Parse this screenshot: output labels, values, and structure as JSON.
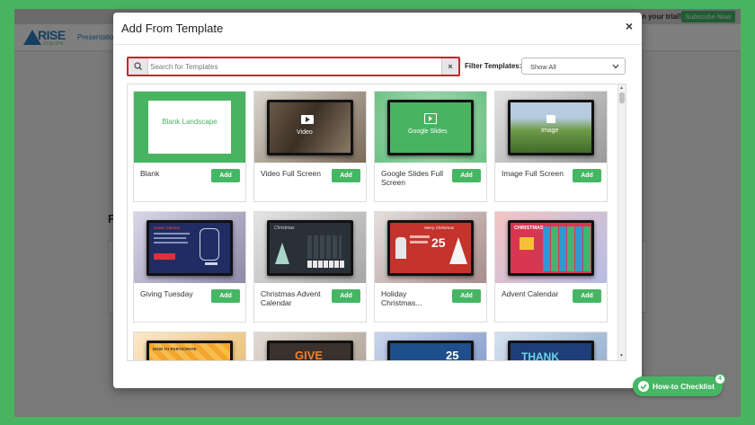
{
  "background_app": {
    "trial_text": "on your trial!",
    "subscribe_label": "Subscribe Now",
    "logo_text": "RISE",
    "logo_sub": "VISION",
    "nav_label": "Presentation",
    "heading_partial": "F"
  },
  "modal": {
    "title": "Add From Template",
    "close_label": "×",
    "search": {
      "placeholder": "Search for Templates",
      "value": "",
      "clear_label": "×"
    },
    "filter": {
      "label": "Filter Templates:",
      "selected": "Show All"
    },
    "add_label": "Add",
    "templates": [
      {
        "name": "Blank",
        "thumb_text": "Blank Landscape"
      },
      {
        "name": "Video Full Screen",
        "thumb_text": "Video"
      },
      {
        "name": "Google Slides Full Screen",
        "thumb_text": "Google Slides"
      },
      {
        "name": "Image Full Screen",
        "thumb_text": "Image"
      },
      {
        "name": "Giving Tuesday",
        "thumb_text": "GIVING TUESDAY"
      },
      {
        "name": "Christmas Advent Calendar",
        "thumb_text": "Christmas"
      },
      {
        "name": "Holiday Christmas...",
        "thumb_text": "Merry Christmas",
        "thumb_number": "25"
      },
      {
        "name": "Advent Calendar",
        "thumb_text": "CHRISTMAS"
      },
      {
        "name": "",
        "thumb_text": "HOW TO PARTICIPATE"
      },
      {
        "name": "",
        "thumb_text": "GIVE"
      },
      {
        "name": "",
        "thumb_number": "25"
      },
      {
        "name": "",
        "thumb_text": "THANK"
      }
    ]
  },
  "checklist": {
    "label": "How-to Checklist",
    "badge": "4"
  },
  "colors": {
    "accent_green": "#45b764",
    "search_border_red": "#d0202a",
    "brand_blue": "#2d7fc1"
  }
}
